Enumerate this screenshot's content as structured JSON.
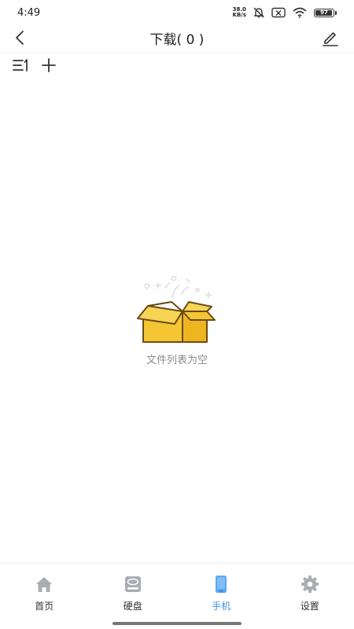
{
  "status_bar": {
    "time": "4:49",
    "net_speed_value": "38.0",
    "net_speed_unit": "KB/s",
    "battery_level": "97"
  },
  "header": {
    "title": "下载( 0 )"
  },
  "empty_state": {
    "message": "文件列表为空"
  },
  "bottom_nav": {
    "items": [
      {
        "label": "首页",
        "icon": "home-icon"
      },
      {
        "label": "硬盘",
        "icon": "hard-drive-icon"
      },
      {
        "label": "手机",
        "icon": "phone-icon"
      },
      {
        "label": "设置",
        "icon": "gear-icon"
      }
    ],
    "active_index": 2
  },
  "colors": {
    "accent": "#3a92e8",
    "box_yellow": "#f5c633",
    "box_outline": "#6b4a12",
    "icon_gray": "#a9adb3"
  }
}
